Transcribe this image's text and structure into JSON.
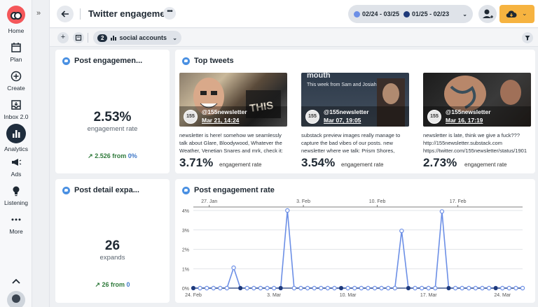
{
  "rail": {
    "home": "Home",
    "plan": "Plan",
    "create": "Create",
    "inbox": "Inbox 2.0",
    "analytics": "Analytics",
    "ads": "Ads",
    "listening": "Listening",
    "more": "More"
  },
  "header": {
    "title": "Twitter engagement",
    "date_current": "02/24 - 03/25",
    "date_compare": "01/25 - 02/23",
    "current_color": "#6c8fe6",
    "compare_color": "#1f3a7a",
    "export_color": "#f6b340"
  },
  "filters": {
    "accounts_count": "2",
    "accounts_label": "social accounts"
  },
  "cards": {
    "engagement": {
      "title": "Post engagemen...",
      "value": "2.53%",
      "label": "engagement rate",
      "delta": "2.526",
      "from_word": "from",
      "prev": "0%"
    },
    "expands": {
      "title": "Post detail expa...",
      "value": "26",
      "label": "expands",
      "delta": "26",
      "from_word": "from",
      "prev": "0"
    },
    "top_tweets": {
      "title": "Top tweets",
      "rate_label": "engagement rate",
      "items": [
        {
          "avatar": "155",
          "handle": "@155newsletter",
          "date": "Mar 21, 14:24",
          "text": "newsletter is here! somehow we seamlessly talk about Glare, Bloodywood, Whatever the Weather, Venetian Snares and mrk, check it:",
          "rate": "3.71%"
        },
        {
          "avatar": "155",
          "handle": "@155newsletter",
          "date": "Mar 07, 19:05",
          "text": "substack preview images really manage to capture the bad vibes of our posts. new newsletter where we talk: Prism Shores,",
          "rate": "3.54%",
          "img_title": "mouth",
          "img_sub": "This week from Sam and Josiah"
        },
        {
          "avatar": "155",
          "handle": "@155newsletter",
          "date": "Mar 16, 17:19",
          "text": "newsletter is late, think we give a fuck??? http://155newsletter.substack.com https://twitter.com/155newsletter/status/1901",
          "rate": "2.73%"
        }
      ]
    },
    "rate_chart": {
      "title": "Post engagement rate"
    }
  },
  "chart_data": {
    "type": "line",
    "title": "Post engagement rate",
    "ylim": [
      0,
      4
    ],
    "y_ticks": [
      "0%",
      "1%",
      "2%",
      "3%",
      "4%"
    ],
    "x_ticks_bottom": [
      "24. Feb",
      "3. Mar",
      "10. Mar",
      "17. Mar",
      "24. Mar"
    ],
    "x_ticks_top": [
      "27. Jan",
      "3. Feb",
      "10. Feb",
      "17. Feb"
    ],
    "grid": true,
    "series": [
      {
        "color": "#6c8fe6",
        "values": [
          0,
          0,
          0,
          0,
          0,
          0,
          1.05,
          0,
          0,
          0,
          0,
          0,
          0,
          0,
          4.0,
          0,
          0,
          0,
          0,
          0,
          0,
          0,
          0,
          0,
          0,
          0,
          0,
          0,
          0,
          0,
          0,
          2.95,
          0,
          0,
          0,
          0,
          0,
          3.95,
          0,
          0,
          0,
          0,
          0,
          0,
          0,
          0,
          0,
          0,
          0,
          0
        ]
      },
      {
        "color": "#1f3a7a",
        "values": [
          0,
          0,
          0,
          0,
          0,
          0,
          0,
          0,
          0,
          0,
          0,
          0,
          0,
          0,
          0,
          0,
          0,
          0,
          0,
          0,
          0,
          0,
          0,
          0,
          0,
          0,
          0,
          0,
          0,
          0,
          0,
          0,
          0,
          0,
          0,
          0,
          0,
          0,
          0,
          0,
          0,
          0,
          0,
          0,
          0,
          0,
          0,
          0,
          0,
          0
        ]
      }
    ]
  }
}
